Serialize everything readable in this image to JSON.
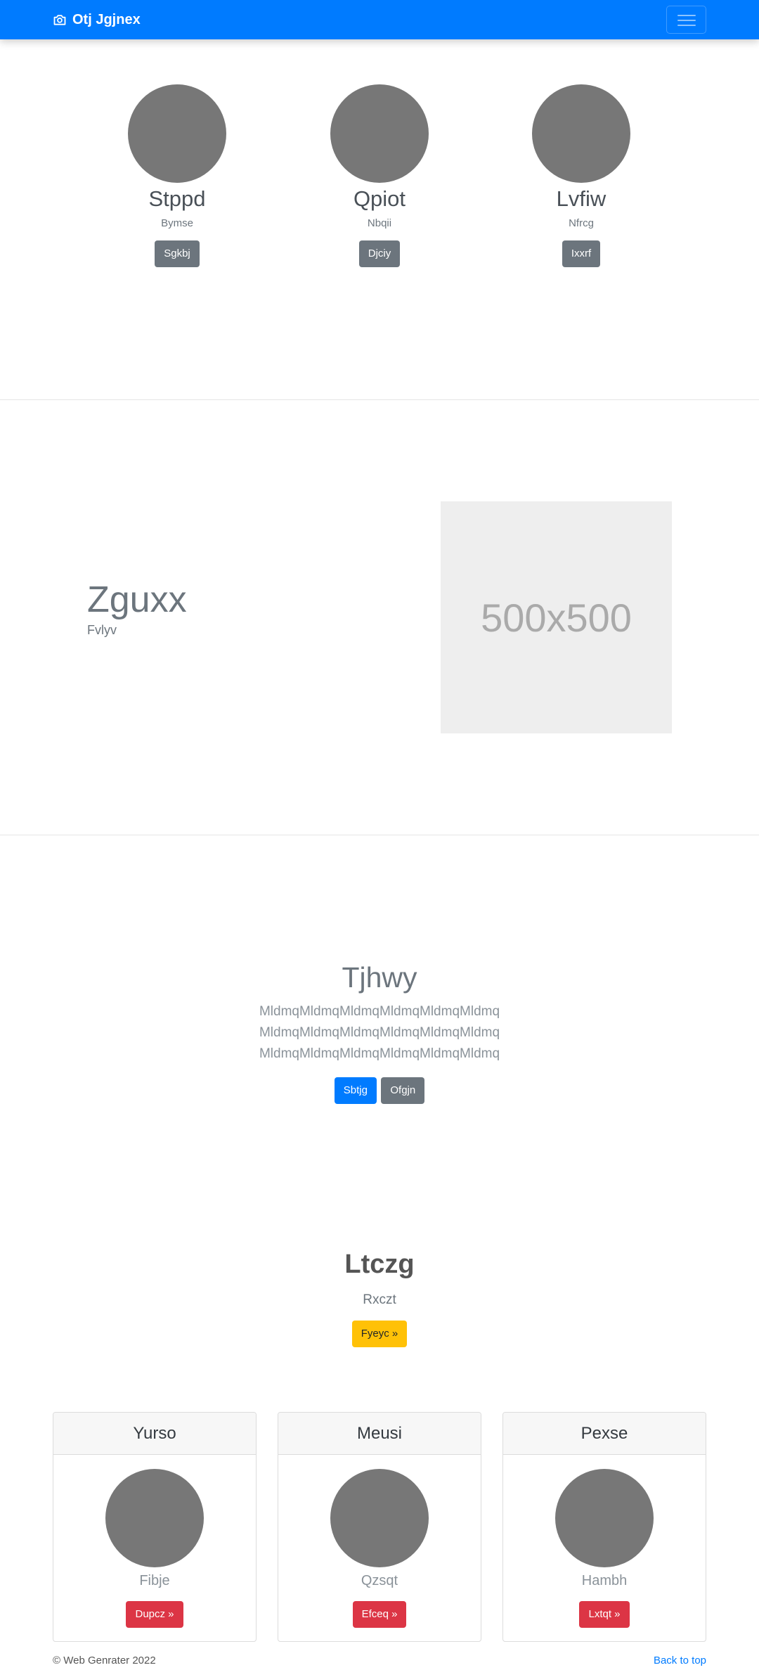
{
  "navbar": {
    "brand": "Otj Jgjnex",
    "brand_icon": "camera-icon",
    "toggle_icon": "hamburger-menu-icon"
  },
  "profiles": [
    {
      "name": "Stppd",
      "subtitle": "Bymse",
      "button": "Sgkbj"
    },
    {
      "name": "Qpiot",
      "subtitle": "Nbqii",
      "button": "Djciy"
    },
    {
      "name": "Lvfiw",
      "subtitle": "Nfrcg",
      "button": "Ixxrf"
    }
  ],
  "feature": {
    "title": "Zguxx",
    "subtitle": "Fvlyv",
    "placeholder": "500x500"
  },
  "jumbotron": {
    "heading": "Tjhwy",
    "lines": [
      "MldmqMldmqMldmqMldmqMldmqMldmq",
      "MldmqMldmqMldmqMldmqMldmqMldmq",
      "MldmqMldmqMldmqMldmqMldmqMldmq"
    ],
    "primary_button": "Sbtjg",
    "secondary_button": "Ofgjn"
  },
  "pricing": {
    "heading": "Ltczg",
    "subtitle": "Rxczt",
    "button": "Fyeyc »"
  },
  "cards": [
    {
      "title": "Yurso",
      "subtitle": "Fibje",
      "button": "Dupcz »"
    },
    {
      "title": "Meusi",
      "subtitle": "Qzsqt",
      "button": "Efceq »"
    },
    {
      "title": "Pexse",
      "subtitle": "Hambh",
      "button": "Lxtqt »"
    }
  ],
  "footer": {
    "copyright": "© Web Genrater 2022",
    "back_to_top": "Back to top"
  },
  "colors": {
    "primary": "#007bff",
    "secondary": "#6c757d",
    "warning": "#ffc107",
    "danger": "#dc3545",
    "avatar": "#777777"
  }
}
